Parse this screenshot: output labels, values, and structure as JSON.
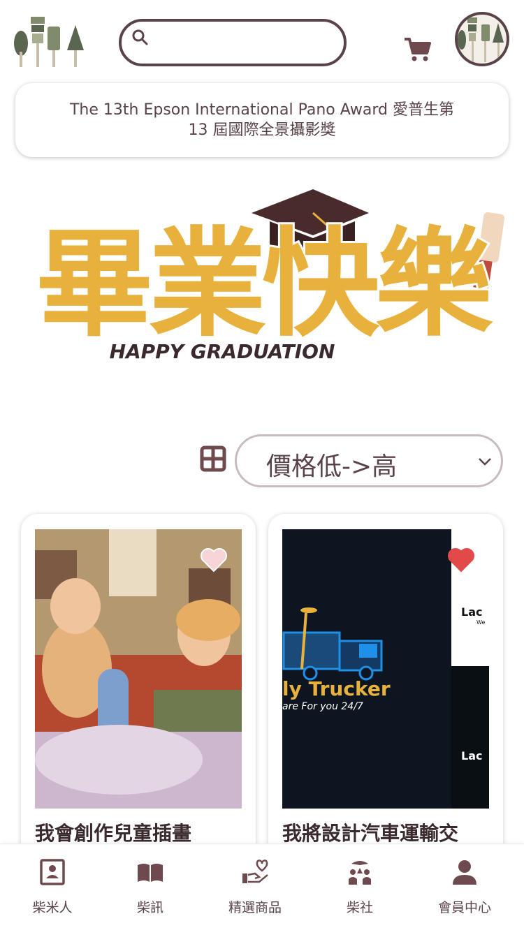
{
  "search": {
    "placeholder": ""
  },
  "announcement": {
    "text": "The 13th Epson International Pano Award 愛普生第 13 屆國際全景攝影獎"
  },
  "banner": {
    "title_zh": "畢業快樂",
    "title_en": "HAPPY GRADUATION"
  },
  "toolbar": {
    "sort_value": "價格低->高"
  },
  "products": [
    {
      "title": "我會創作兒童插畫",
      "favorited": false
    },
    {
      "title": "我將設計汽車運輸交",
      "favorited": true,
      "thumb_text_main": "ly Trucker",
      "thumb_text_sub": "are For you 24/7",
      "thumb_side_text_1": "Lac",
      "thumb_side_text_2": "Lac",
      "thumb_side_sub": "We"
    }
  ],
  "bottom_nav": [
    {
      "label": "柴米人",
      "icon": "contact-card-icon"
    },
    {
      "label": "柴訊",
      "icon": "open-book-icon"
    },
    {
      "label": "精選商品",
      "icon": "hand-heart-icon"
    },
    {
      "label": "柴社",
      "icon": "community-icon"
    },
    {
      "label": "會員中心",
      "icon": "user-icon"
    }
  ],
  "colors": {
    "brand": "#5a4348",
    "heart_active": "#e24a4a",
    "banner_gold": "#e8b13c"
  }
}
